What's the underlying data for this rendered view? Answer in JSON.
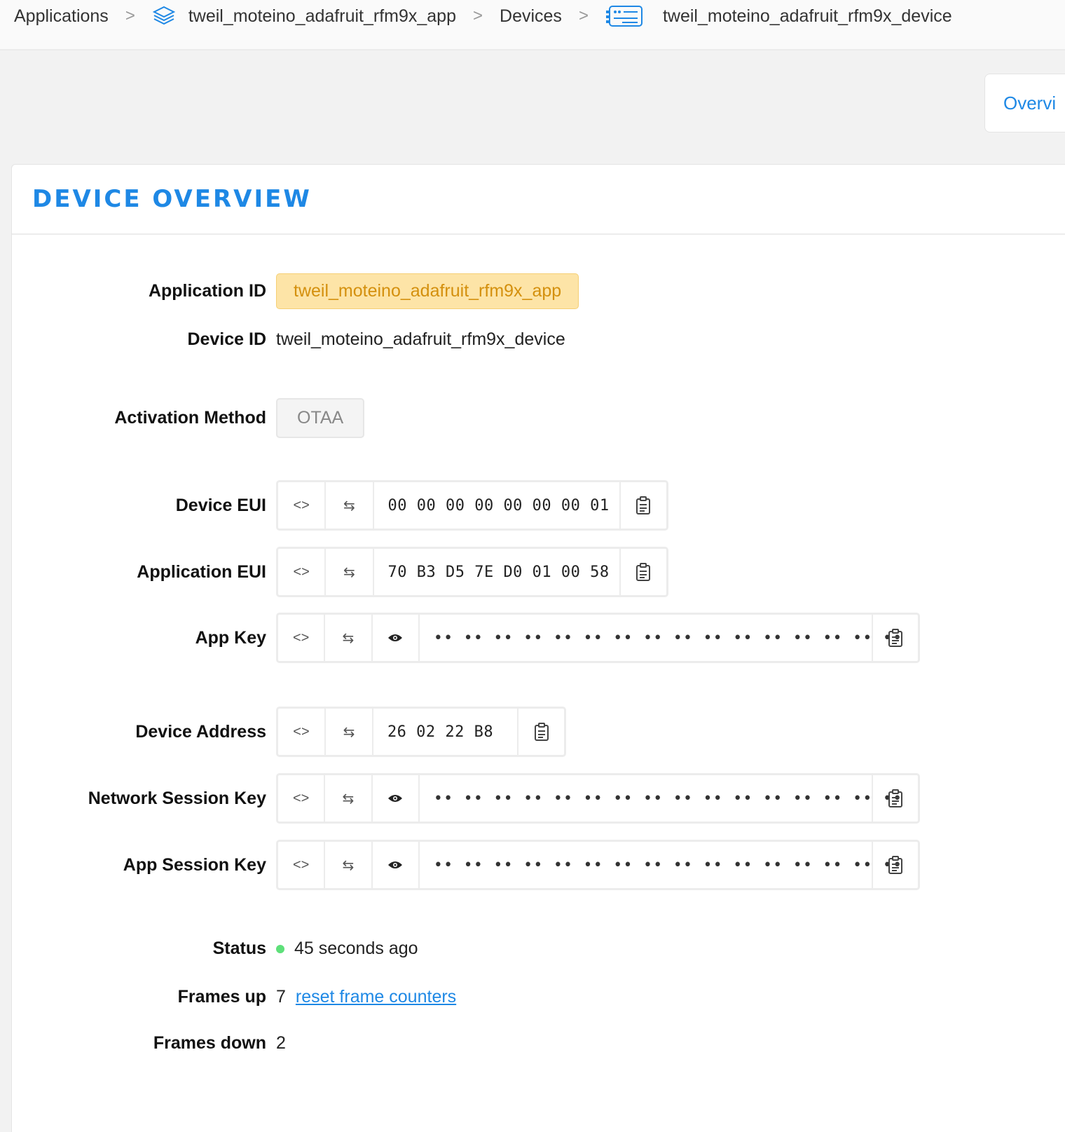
{
  "breadcrumb": {
    "applications": "Applications",
    "app": "tweil_moteino_adafruit_rfm9x_app",
    "devices": "Devices",
    "device": "tweil_moteino_adafruit_rfm9x_device",
    "separator": ">"
  },
  "tabs": {
    "overview": "Overvi"
  },
  "panel": {
    "title": "DEVICE OVERVIEW"
  },
  "fields": {
    "application_id": {
      "label": "Application ID",
      "value": "tweil_moteino_adafruit_rfm9x_app"
    },
    "device_id": {
      "label": "Device ID",
      "value": "tweil_moteino_adafruit_rfm9x_device"
    },
    "activation_method": {
      "label": "Activation Method",
      "value": "OTAA"
    },
    "device_eui": {
      "label": "Device EUI",
      "value": "00 00 00 00 00 00 00 01"
    },
    "application_eui": {
      "label": "Application EUI",
      "value": "70 B3 D5 7E D0 01 00 58"
    },
    "app_key": {
      "label": "App Key",
      "value": "•• •• •• •• •• •• •• •• •• •• •• •• •• •• •• ••"
    },
    "device_address": {
      "label": "Device Address",
      "value": "26 02 22 B8"
    },
    "network_session_key": {
      "label": "Network Session Key",
      "value": "•• •• •• •• •• •• •• •• •• •• •• •• •• •• •• ••"
    },
    "app_session_key": {
      "label": "App Session Key",
      "value": "•• •• •• •• •• •• •• •• •• •• •• •• •• •• •• ••"
    },
    "status": {
      "label": "Status",
      "value": "45 seconds ago",
      "dot_color": "#5ee07a"
    },
    "frames_up": {
      "label": "Frames up",
      "value": "7",
      "link": "reset frame counters"
    },
    "frames_down": {
      "label": "Frames down",
      "value": "2"
    }
  },
  "buttons": {
    "code": "<>",
    "swap": "⇆"
  },
  "colors": {
    "accent": "#1e88e5",
    "app_tag_bg": "#fde4a7",
    "app_tag_text": "#d4900e"
  }
}
